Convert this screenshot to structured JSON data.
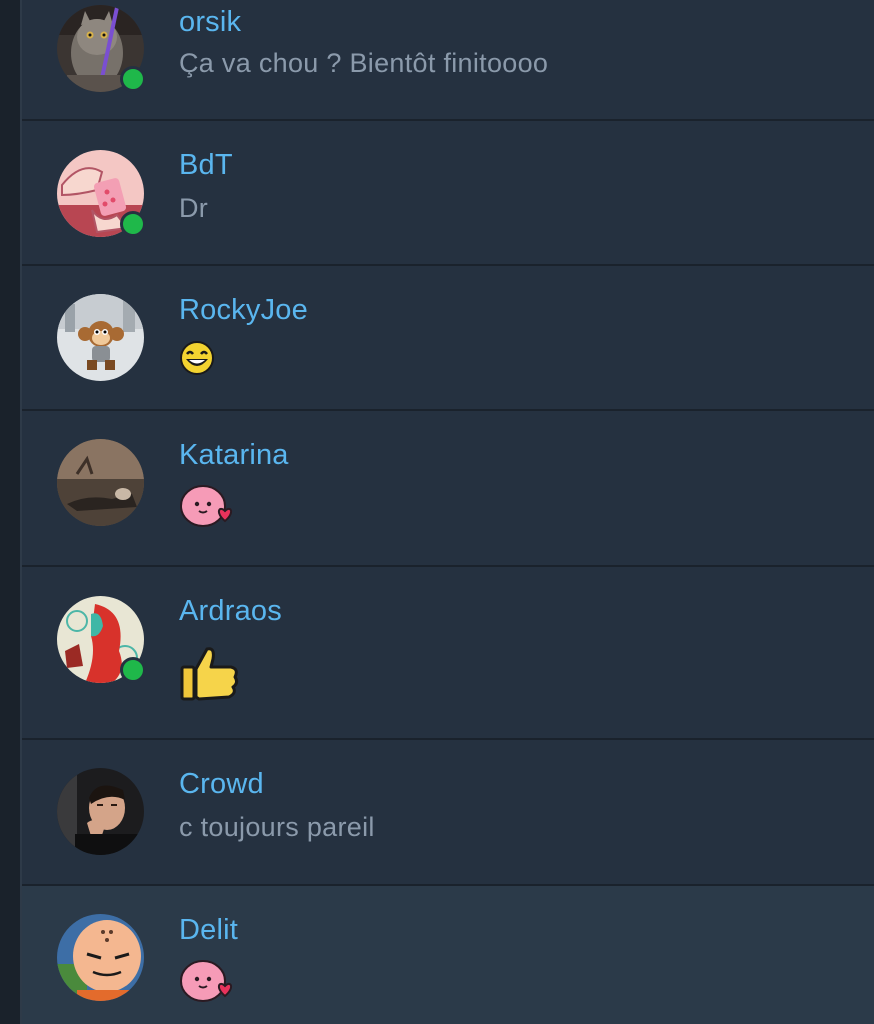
{
  "conversations": [
    {
      "name": "orsik",
      "message": "Ça va chou ? Bientôt finitoooo",
      "online": true,
      "avatar": "cat-avatar"
    },
    {
      "name": "BdT",
      "message": "Dr",
      "online": true,
      "avatar": "hands-pink-avatar"
    },
    {
      "name": "RockyJoe",
      "message": "",
      "online": false,
      "avatar": "monkey-avatar",
      "sticker": "laughing-emoji"
    },
    {
      "name": "Katarina",
      "message": "",
      "online": false,
      "avatar": "lying-person-avatar",
      "sticker": "pink-blob-heart-sticker"
    },
    {
      "name": "Ardraos",
      "message": "",
      "online": true,
      "avatar": "red-hair-illustration-avatar",
      "sticker": "thumbs-up-emoji"
    },
    {
      "name": "Crowd",
      "message": "c toujours pareil",
      "online": false,
      "avatar": "man-thinking-avatar"
    },
    {
      "name": "Delit",
      "message": "",
      "online": false,
      "avatar": "bald-cartoon-avatar",
      "sticker": "pink-blob-heart-sticker",
      "selected": true
    }
  ],
  "colors": {
    "background": "#253140",
    "name": "#5ab6ef",
    "message": "#8b9aab",
    "online": "#1fb84a",
    "selected_row": "#2b3a49"
  }
}
